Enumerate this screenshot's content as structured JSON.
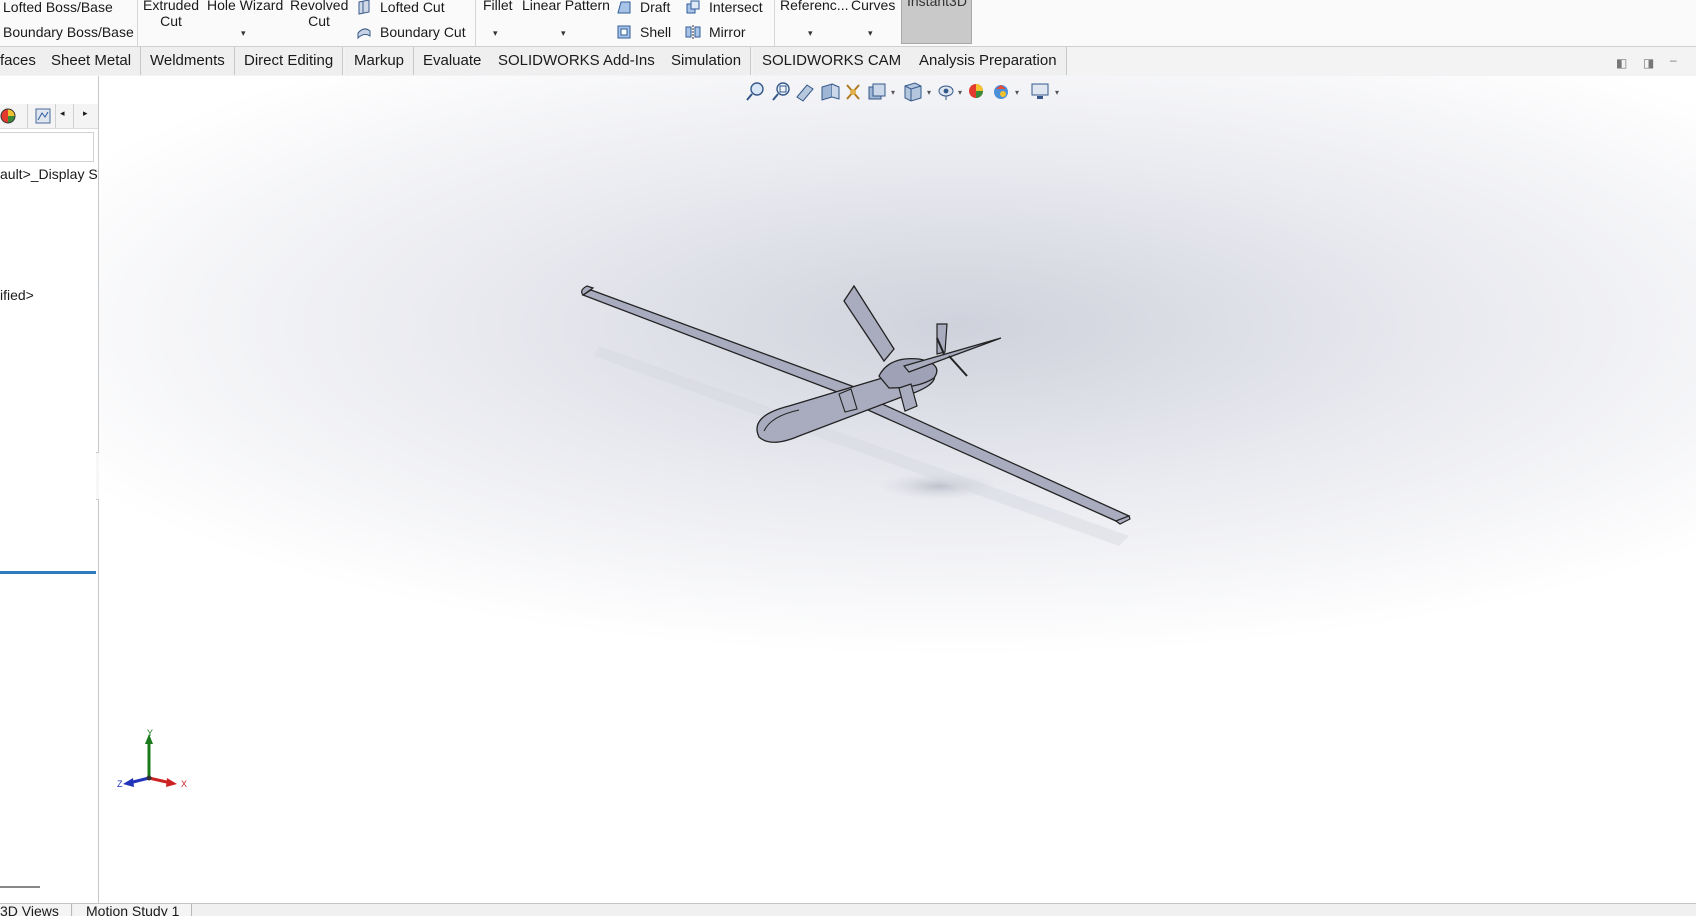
{
  "ribbon": {
    "lofted_boss": "Lofted Boss/Base",
    "boundary_boss": "Boundary Boss/Base",
    "extruded_cut_1": "Extruded",
    "extruded_cut_2": "Cut",
    "hole_wizard": "Hole Wizard",
    "revolved_cut_1": "Revolved",
    "revolved_cut_2": "Cut",
    "lofted_cut": "Lofted Cut",
    "boundary_cut": "Boundary Cut",
    "fillet": "Fillet",
    "linear_pattern": "Linear Pattern",
    "draft": "Draft",
    "shell": "Shell",
    "intersect": "Intersect",
    "mirror": "Mirror",
    "reference": "Referenc...",
    "curves": "Curves",
    "instant3d": "Instant3D"
  },
  "tabs": [
    "faces",
    "Sheet Metal",
    "Weldments",
    "Direct Editing",
    "Markup",
    "Evaluate",
    "SOLIDWORKS Add-Ins",
    "Simulation",
    "SOLIDWORKS CAM",
    "Analysis Preparation"
  ],
  "left_panel": {
    "display_state": "ault>_Display S",
    "material": "ified>"
  },
  "triad": {
    "y": "Y",
    "x": "X",
    "z": "Z"
  },
  "bottom_tabs": [
    "3D Views",
    "Motion Study 1"
  ],
  "colors": {
    "model_fill": "#a9acbf",
    "triad_y": "#1a7a1a",
    "triad_x": "#cc2222",
    "triad_z": "#2233bb",
    "selection_line": "#2d7cc0"
  }
}
